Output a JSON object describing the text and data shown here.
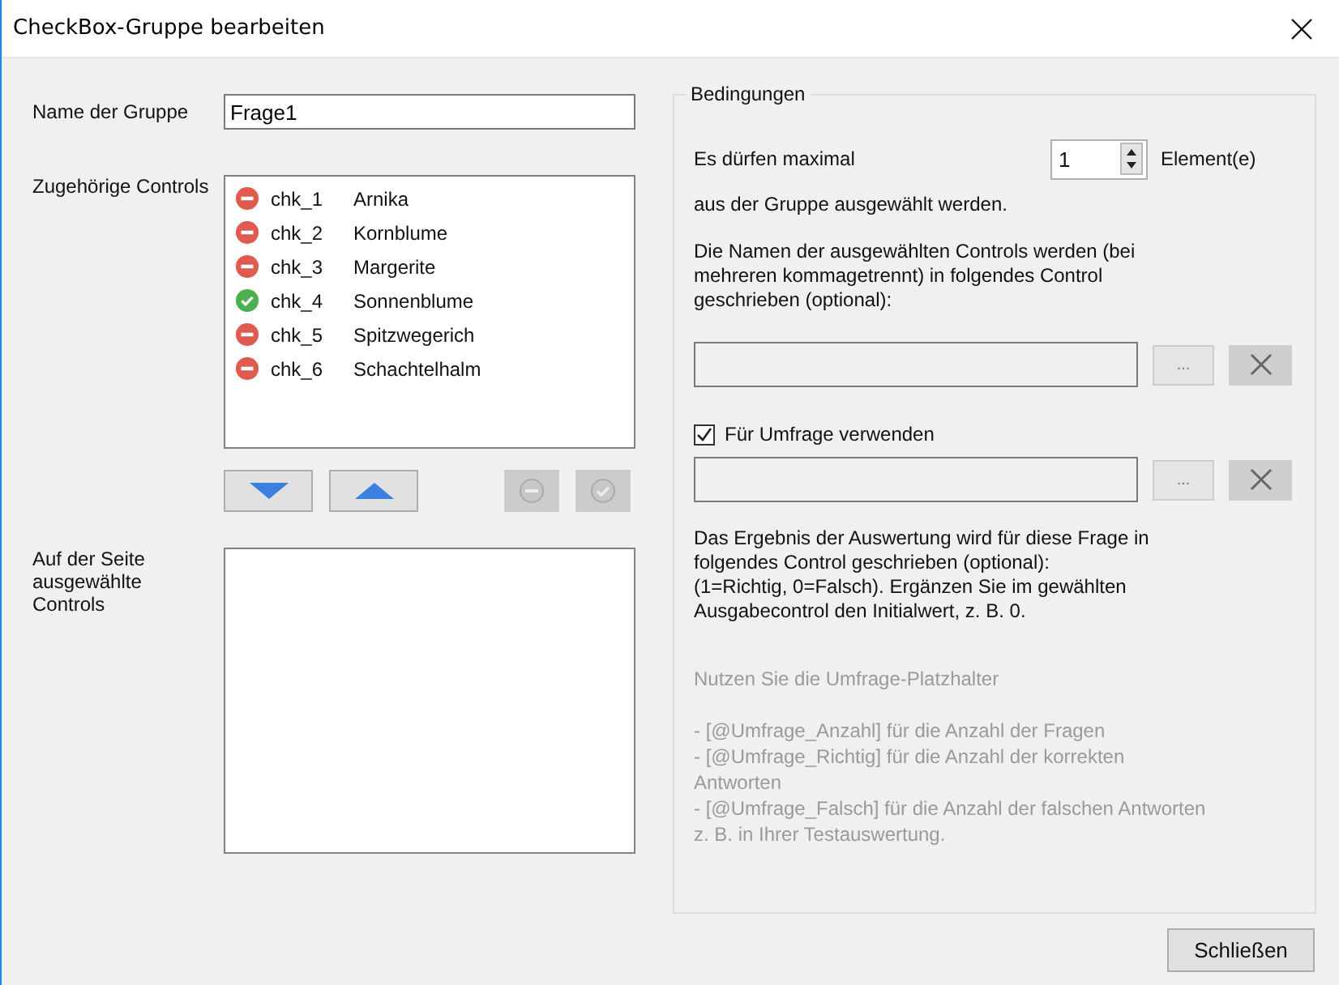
{
  "window": {
    "title": "CheckBox-Gruppe bearbeiten"
  },
  "group_name": {
    "label": "Name der Gruppe",
    "value": "Frage1"
  },
  "members": {
    "label": "Zugehörige Controls",
    "items": [
      {
        "name": "chk_1",
        "text": "Arnika",
        "checked": false
      },
      {
        "name": "chk_2",
        "text": "Kornblume",
        "checked": false
      },
      {
        "name": "chk_3",
        "text": "Margerite",
        "checked": false
      },
      {
        "name": "chk_4",
        "text": "Sonnenblume",
        "checked": true
      },
      {
        "name": "chk_5",
        "text": "Spitzwegerich",
        "checked": false
      },
      {
        "name": "chk_6",
        "text": "Schachtelhalm",
        "checked": false
      }
    ]
  },
  "list_buttons": [
    {
      "kind": "down",
      "disabled": false
    },
    {
      "kind": "up",
      "disabled": false
    },
    {
      "kind": "uncheck",
      "disabled": true
    },
    {
      "kind": "check",
      "disabled": true
    }
  ],
  "page_selection": {
    "label": "Auf der Seite ausgewählte Controls"
  },
  "conditions": {
    "legend": "Bedingungen",
    "max_label": "Es dürfen maximal",
    "max_value": "1",
    "max_unit": "Element(e)",
    "max_suffix": "aus der Gruppe ausgewählt werden.",
    "output_note": [
      "Die Namen der ausgewählten Controls werden (bei",
      "mehreren kommagetrennt) in folgendes  Control",
      "geschrieben (optional):"
    ],
    "output_field": {
      "browse": "...",
      "clear_disabled": true
    },
    "survey": {
      "label": "Für Umfrage verwenden",
      "checked": true
    },
    "survey_field": {
      "browse": "...",
      "clear_disabled": true
    },
    "result_note": [
      "Das Ergebnis der Auswertung wird für diese Frage in",
      "folgendes Control geschrieben (optional):",
      "(1=Richtig, 0=Falsch). Ergänzen Sie im gewählten",
      "Ausgabecontrol den Initialwert, z. B. 0."
    ],
    "hint_title": "Nutzen Sie die Umfrage-Platzhalter",
    "hint_lines": [
      "- [@Umfrage_Anzahl] für die Anzahl der Fragen",
      "- [@Umfrage_Richtig] für die Anzahl der korrekten",
      "Antworten",
      "- [@Umfrage_Falsch] für die Anzahl der falschen Antworten",
      "z. B. in Ihrer Testauswertung."
    ]
  },
  "close_button": "Schließen"
}
